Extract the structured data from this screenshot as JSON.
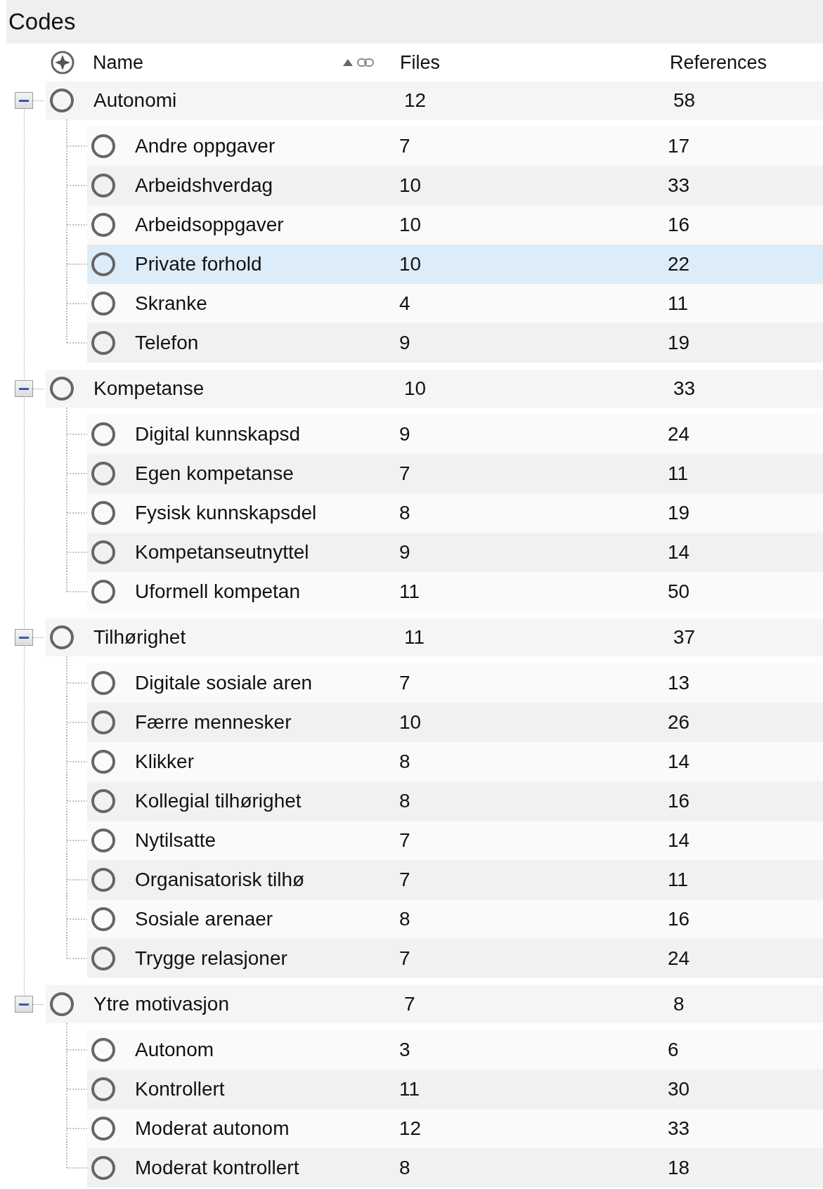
{
  "panel": {
    "title": "Codes"
  },
  "columns": [
    {
      "label": "Name",
      "sorted": true,
      "linked": true
    },
    {
      "label": "Files"
    },
    {
      "label": "References"
    }
  ],
  "groups": [
    {
      "name": "Autonomi",
      "files": "12",
      "references": "58",
      "expanded": true,
      "selected": false,
      "children": [
        {
          "name": "Andre oppgaver",
          "files": "7",
          "references": "17",
          "selected": false
        },
        {
          "name": "Arbeidshverdag",
          "files": "10",
          "references": "33",
          "selected": false
        },
        {
          "name": "Arbeidsoppgaver",
          "files": "10",
          "references": "16",
          "selected": false
        },
        {
          "name": "Private forhold",
          "files": "10",
          "references": "22",
          "selected": true
        },
        {
          "name": "Skranke",
          "files": "4",
          "references": "11",
          "selected": false
        },
        {
          "name": "Telefon",
          "files": "9",
          "references": "19",
          "selected": false
        }
      ]
    },
    {
      "name": "Kompetanse",
      "files": "10",
      "references": "33",
      "expanded": true,
      "selected": false,
      "children": [
        {
          "name": "Digital kunnskapsd",
          "files": "9",
          "references": "24",
          "selected": false
        },
        {
          "name": "Egen kompetanse",
          "files": "7",
          "references": "11",
          "selected": false
        },
        {
          "name": "Fysisk kunnskapsdel",
          "files": "8",
          "references": "19",
          "selected": false
        },
        {
          "name": "Kompetanseutnyttel",
          "files": "9",
          "references": "14",
          "selected": false
        },
        {
          "name": "Uformell kompetan",
          "files": "11",
          "references": "50",
          "selected": false
        }
      ]
    },
    {
      "name": "Tilhørighet",
      "files": "11",
      "references": "37",
      "expanded": true,
      "selected": false,
      "children": [
        {
          "name": "Digitale sosiale aren",
          "files": "7",
          "references": "13",
          "selected": false
        },
        {
          "name": "Færre mennesker",
          "files": "10",
          "references": "26",
          "selected": false
        },
        {
          "name": "Klikker",
          "files": "8",
          "references": "14",
          "selected": false
        },
        {
          "name": "Kollegial tilhørighet",
          "files": "8",
          "references": "16",
          "selected": false
        },
        {
          "name": "Nytilsatte",
          "files": "7",
          "references": "14",
          "selected": false
        },
        {
          "name": "Organisatorisk tilhø",
          "files": "7",
          "references": "11",
          "selected": false
        },
        {
          "name": "Sosiale arenaer",
          "files": "8",
          "references": "16",
          "selected": false
        },
        {
          "name": "Trygge relasjoner",
          "files": "7",
          "references": "24",
          "selected": false
        }
      ]
    },
    {
      "name": "Ytre motivasjon",
      "files": "7",
      "references": "8",
      "expanded": true,
      "selected": false,
      "children": [
        {
          "name": "Autonom",
          "files": "3",
          "references": "6",
          "selected": false
        },
        {
          "name": "Kontrollert",
          "files": "11",
          "references": "30",
          "selected": false
        },
        {
          "name": "Moderat autonom",
          "files": "12",
          "references": "33",
          "selected": false
        },
        {
          "name": "Moderat kontrollert",
          "files": "8",
          "references": "18",
          "selected": false
        }
      ]
    }
  ]
}
